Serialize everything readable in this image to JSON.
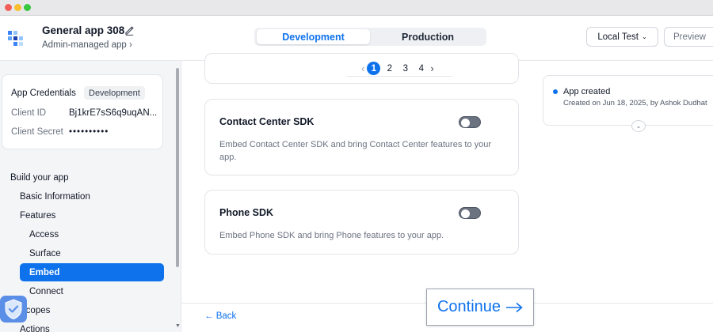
{
  "header": {
    "app_name": "General app 308",
    "app_subtitle": "Admin-managed app ›",
    "env_tabs": [
      "Development",
      "Production"
    ],
    "local_test_label": "Local Test",
    "preview_label": "Preview"
  },
  "credentials": {
    "title": "App Credentials",
    "env_badge": "Development",
    "client_id_label": "Client ID",
    "client_id_value": "Bj1krE7sS6q9uqAN...",
    "client_secret_label": "Client Secret",
    "client_secret_value": "••••••••••"
  },
  "sidebar": {
    "group_label": "Build your app",
    "items": [
      "Basic Information",
      "Features",
      "Access",
      "Surface",
      "Embed",
      "Connect",
      "Scopes",
      "Actions"
    ],
    "active_item": "Embed"
  },
  "pagination": {
    "pages": [
      "1",
      "2",
      "3",
      "4"
    ],
    "current": "1"
  },
  "sdk_cards": [
    {
      "title": "Contact Center SDK",
      "description": "Embed Contact Center SDK and bring Contact Center features to your app.",
      "enabled": false
    },
    {
      "title": "Phone SDK",
      "description": "Embed Phone SDK and bring Phone features to your app.",
      "enabled": false
    }
  ],
  "footer": {
    "back_label": "← Back",
    "continue_label": "Continue"
  },
  "activity": {
    "title": "App created",
    "subtitle": "Created on Jun 18, 2025, by Ashok Dudhat"
  },
  "colors": {
    "accent": "#0e72ed",
    "toggle_off": "#6b7280"
  }
}
